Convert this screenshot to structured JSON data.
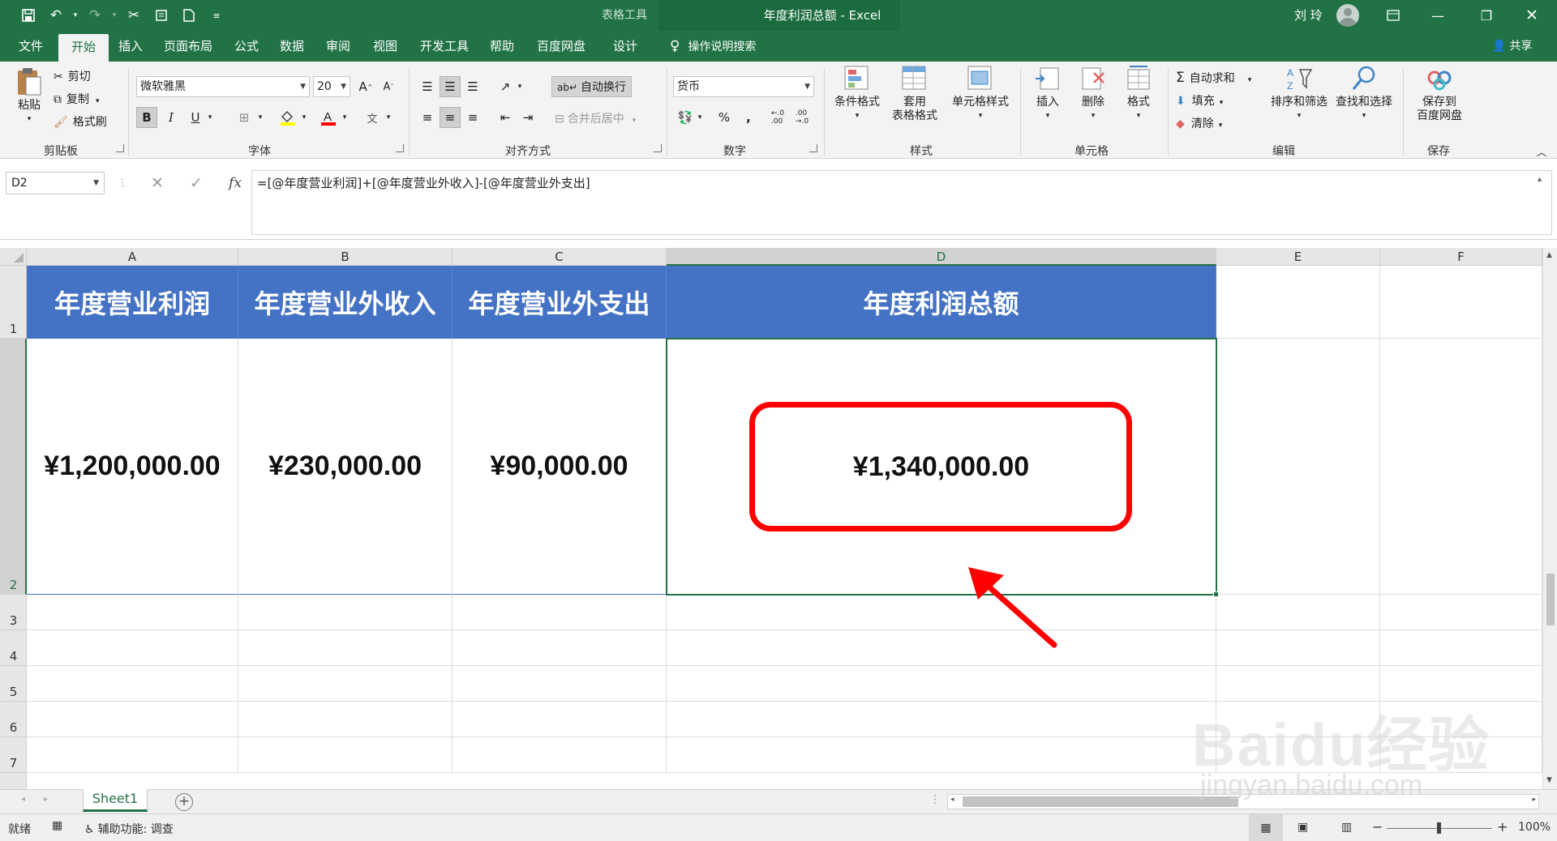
{
  "titlebar": {
    "context_tools": "表格工具",
    "doc_title": "年度利润总额  -  Excel",
    "user_name": "刘 玲"
  },
  "tabs": [
    "文件",
    "开始",
    "插入",
    "页面布局",
    "公式",
    "数据",
    "审阅",
    "视图",
    "开发工具",
    "帮助",
    "百度网盘",
    "设计"
  ],
  "active_tab": "开始",
  "tell_me": "操作说明搜索",
  "share": "共享",
  "ribbon": {
    "clipboard": {
      "label": "剪贴板",
      "paste": "粘贴",
      "cut": "剪切",
      "copy": "复制",
      "format_painter": "格式刷"
    },
    "font": {
      "label": "字体",
      "name": "微软雅黑",
      "size": "20",
      "bold": "B",
      "italic": "I",
      "underline": "U"
    },
    "alignment": {
      "label": "对齐方式",
      "wrap_text": "自动换行",
      "merge_center": "合并后居中"
    },
    "number": {
      "label": "数字",
      "format": "货币",
      "percent": "%",
      "comma": ","
    },
    "styles": {
      "label": "样式",
      "conditional": "条件格式",
      "format_table_1": "套用",
      "format_table_2": "表格格式",
      "cell_styles": "单元格样式"
    },
    "cells": {
      "label": "单元格",
      "insert": "插入",
      "delete": "删除",
      "format": "格式"
    },
    "editing": {
      "label": "编辑",
      "autosum": "自动求和",
      "fill": "填充",
      "clear": "清除",
      "sort_filter": "排序和筛选",
      "find_select": "查找和选择"
    },
    "save": {
      "label": "保存",
      "save_to_1": "保存到",
      "save_to_2": "百度网盘"
    }
  },
  "formula_bar": {
    "name_box": "D2",
    "formula": "=[@年度营业利润]+[@年度营业外收入]-[@年度营业外支出]"
  },
  "sheet": {
    "columns": [
      "A",
      "B",
      "C",
      "D",
      "E",
      "F"
    ],
    "rows": [
      "1",
      "2",
      "3",
      "4",
      "5",
      "6",
      "7"
    ],
    "headers": [
      "年度营业利润",
      "年度营业外收入",
      "年度营业外支出",
      "年度利润总额"
    ],
    "values": [
      "¥1,200,000.00",
      "¥230,000.00",
      "¥90,000.00",
      "¥1,340,000.00"
    ],
    "selected_cell": "D2",
    "header_color": "#4472c4",
    "accent_color": "#217346",
    "annotation_color": "#ff0000"
  },
  "sheet_tabs": {
    "active": "Sheet1"
  },
  "statusbar": {
    "ready": "就绪",
    "accessibility": "辅助功能: 调查",
    "zoom": "100%"
  },
  "watermark": {
    "brand": "Baidu经验",
    "url": "jingyan.baidu.com"
  }
}
